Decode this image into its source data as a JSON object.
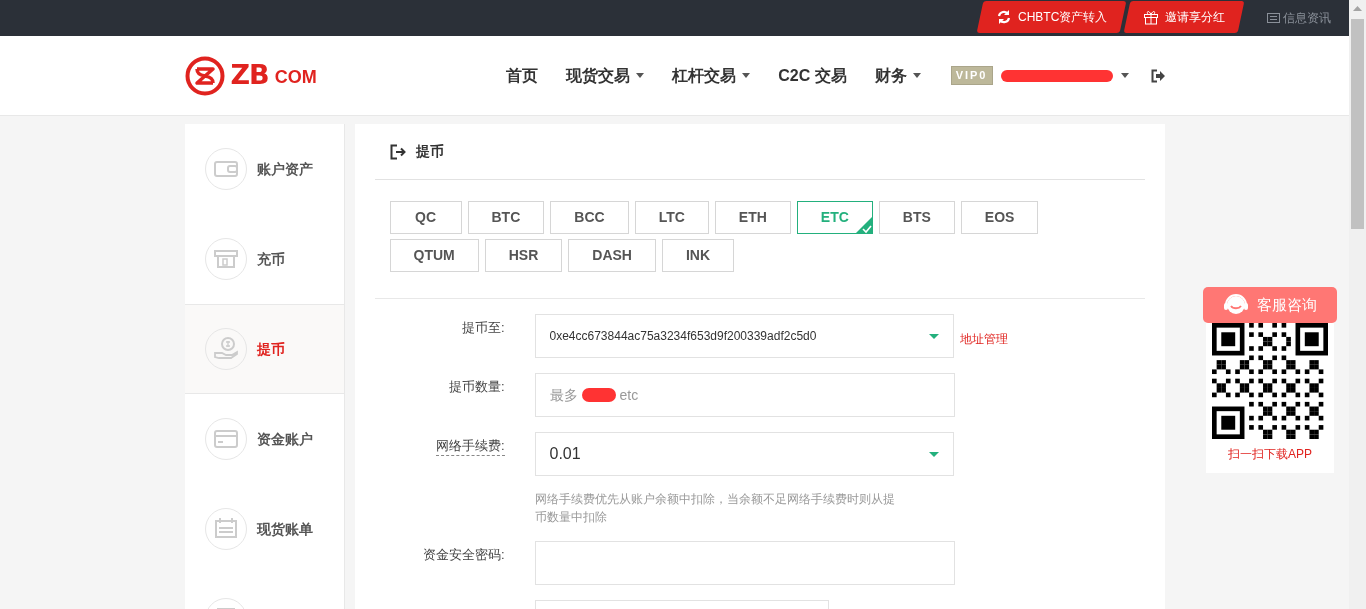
{
  "top_bar": {
    "links": [
      {
        "label": "CHBTC资产转入",
        "kind": "transfer"
      },
      {
        "label": "邀请享分红",
        "kind": "invite"
      },
      {
        "label": "信息资讯",
        "kind": "news"
      }
    ]
  },
  "header": {
    "logo": {
      "mark": "ZB",
      "suffix": "COM"
    },
    "nav": [
      {
        "label": "首页",
        "dropdown": false
      },
      {
        "label": "现货交易",
        "dropdown": true
      },
      {
        "label": "杠杆交易",
        "dropdown": true
      },
      {
        "label": "C2C 交易",
        "dropdown": false
      },
      {
        "label": "财务",
        "dropdown": true
      }
    ],
    "user": {
      "vip": "VIP0",
      "dropdown": true
    }
  },
  "sidebar": {
    "items": [
      {
        "label": "账户资产",
        "selected": false
      },
      {
        "label": "充币",
        "selected": false
      },
      {
        "label": "提币",
        "selected": true
      },
      {
        "label": "资金账户",
        "selected": false
      },
      {
        "label": "现货账单",
        "selected": false
      }
    ]
  },
  "panel": {
    "title": "提币",
    "coins": [
      {
        "label": "QC",
        "selected": false
      },
      {
        "label": "BTC",
        "selected": false
      },
      {
        "label": "BCC",
        "selected": false
      },
      {
        "label": "LTC",
        "selected": false
      },
      {
        "label": "ETH",
        "selected": false
      },
      {
        "label": "ETC",
        "selected": true
      },
      {
        "label": "BTS",
        "selected": false
      },
      {
        "label": "EOS",
        "selected": false
      },
      {
        "label": "QTUM",
        "selected": false
      },
      {
        "label": "HSR",
        "selected": false
      },
      {
        "label": "DASH",
        "selected": false
      },
      {
        "label": "INK",
        "selected": false
      }
    ],
    "fields": [
      {
        "kind": "select",
        "label": "提币至:",
        "value": "0xe4cc673844ac75a3234f653d9f200339adf2c5d0",
        "link": "地址管理"
      },
      {
        "kind": "amount",
        "label": "提币数量:",
        "placeholder": "最多",
        "placeholder_suffix": "etc"
      },
      {
        "kind": "select",
        "label": "网络手续费:",
        "value": "0.01",
        "tooltip": true,
        "hint": "网络手续费优先从账户余额中扣除，当余额不足网络手续费时则从提币数量中扣除"
      },
      {
        "kind": "input",
        "label": "资金安全密码:"
      },
      {
        "kind": "input"
      }
    ]
  },
  "service": {
    "button": "客服咨询",
    "caption": "扫一扫下载APP"
  }
}
